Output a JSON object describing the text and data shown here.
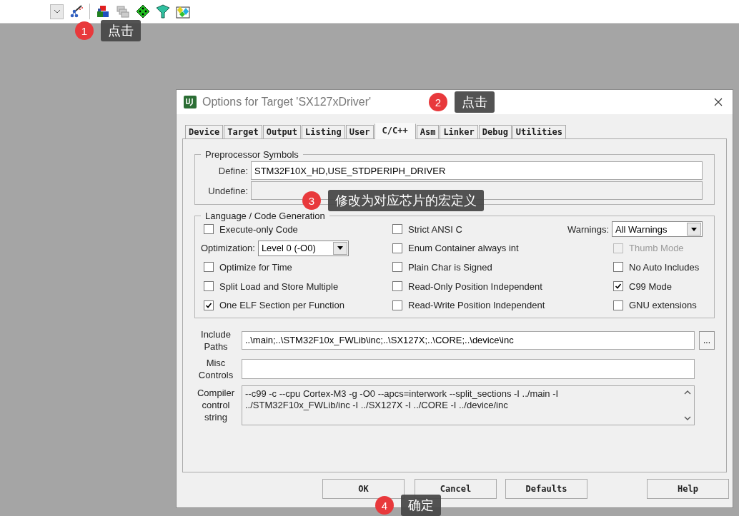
{
  "dialog": {
    "title": "Options for Target 'SX127xDriver'"
  },
  "tabs": [
    {
      "label": "Device",
      "selected": false
    },
    {
      "label": "Target",
      "selected": false
    },
    {
      "label": "Output",
      "selected": false
    },
    {
      "label": "Listing",
      "selected": false
    },
    {
      "label": "User",
      "selected": false
    },
    {
      "label": "C/C++",
      "selected": true
    },
    {
      "label": "Asm",
      "selected": false
    },
    {
      "label": "Linker",
      "selected": false
    },
    {
      "label": "Debug",
      "selected": false
    },
    {
      "label": "Utilities",
      "selected": false
    }
  ],
  "preprocessor": {
    "title": "Preprocessor Symbols",
    "define_label": "Define:",
    "define_value": "STM32F10X_HD,USE_STDPERIPH_DRIVER",
    "undefine_label": "Undefine:"
  },
  "language": {
    "title": "Language / Code Generation",
    "columns": [
      [
        {
          "kind": "checkbox",
          "label": "Execute-only Code",
          "checked": false,
          "disabled": false
        },
        {
          "kind": "dropdown",
          "label": "Optimization:",
          "value": "Level 0 (-O0)"
        },
        {
          "kind": "checkbox",
          "label": "Optimize for Time",
          "checked": false,
          "disabled": false
        },
        {
          "kind": "checkbox",
          "label": "Split Load and Store Multiple",
          "checked": false,
          "disabled": false
        },
        {
          "kind": "checkbox",
          "label": "One ELF Section per Function",
          "checked": true,
          "disabled": false
        }
      ],
      [
        {
          "kind": "checkbox",
          "label": "Strict ANSI C",
          "checked": false,
          "disabled": false
        },
        {
          "kind": "checkbox",
          "label": "Enum Container always int",
          "checked": false,
          "disabled": false
        },
        {
          "kind": "checkbox",
          "label": "Plain Char is Signed",
          "checked": false,
          "disabled": false
        },
        {
          "kind": "checkbox",
          "label": "Read-Only Position Independent",
          "checked": false,
          "disabled": false
        },
        {
          "kind": "checkbox",
          "label": "Read-Write Position Independent",
          "checked": false,
          "disabled": false
        }
      ],
      [
        {
          "kind": "dropdown",
          "label": "Warnings:",
          "value": "All Warnings"
        },
        {
          "kind": "checkbox",
          "label": "Thumb Mode",
          "checked": false,
          "disabled": true
        },
        {
          "kind": "checkbox",
          "label": "No Auto Includes",
          "checked": false,
          "disabled": false
        },
        {
          "kind": "checkbox",
          "label": "C99 Mode",
          "checked": true,
          "disabled": false
        },
        {
          "kind": "checkbox",
          "label": "GNU extensions",
          "checked": false,
          "disabled": false
        }
      ]
    ]
  },
  "include_paths": {
    "label": "Include Paths",
    "value": "..\\main;..\\STM32F10x_FWLib\\inc;..\\SX127X;..\\CORE;..\\device\\inc",
    "browse": "..."
  },
  "misc_controls": {
    "label": "Misc Controls"
  },
  "compiler_string": {
    "label": "Compiler control string",
    "lines": [
      "--c99 -c --cpu Cortex-M3 -g -O0 --apcs=interwork --split_sections -I ../main -I",
      "../STM32F10x_FWLib/inc -I ../SX127X -I ../CORE -I ../device/inc"
    ]
  },
  "buttons": [
    "OK",
    "Cancel",
    "Defaults",
    "Help"
  ],
  "callouts": [
    {
      "number": "1",
      "text": "点击"
    },
    {
      "number": "2",
      "text": "点击"
    },
    {
      "number": "3",
      "text": "修改为对应芯片的宏定义"
    },
    {
      "number": "4",
      "text": "确定"
    }
  ]
}
